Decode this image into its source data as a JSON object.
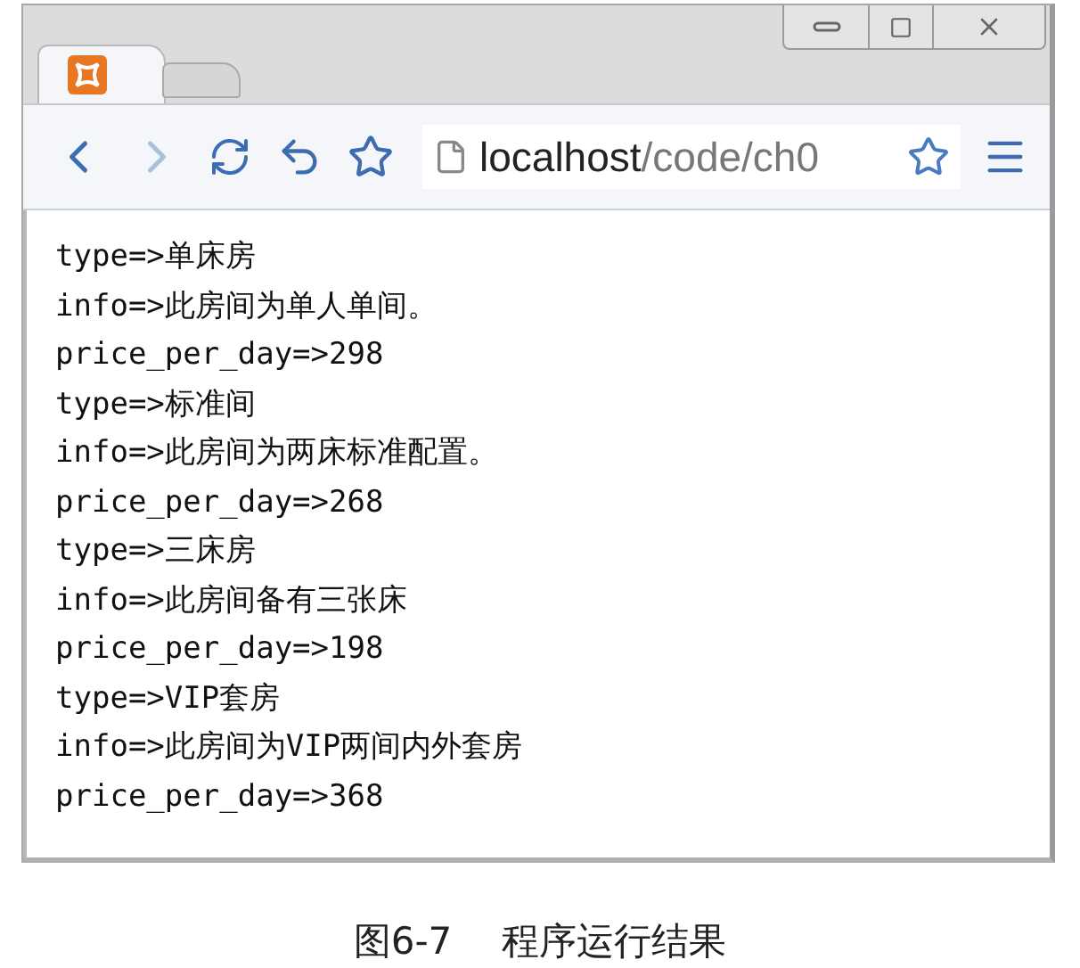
{
  "browser": {
    "address": {
      "host": "localhost",
      "path": "/code/ch0"
    }
  },
  "output_lines": [
    "type=>单床房",
    "info=>此房间为单人单间。",
    "price_per_day=>298",
    "type=>标准间",
    "info=>此房间为两床标准配置。",
    "price_per_day=>268",
    "type=>三床房",
    "info=>此房间备有三张床",
    "price_per_day=>198",
    "type=>VIP套房",
    "info=>此房间为VIP两间内外套房",
    "price_per_day=>368"
  ],
  "caption": {
    "figure": "图6-7",
    "title": "程序运行结果"
  }
}
